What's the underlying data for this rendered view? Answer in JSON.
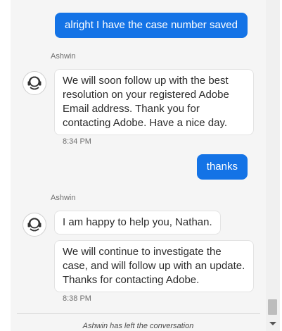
{
  "messages": {
    "user_1": "alright I have the case number saved",
    "agent_name_1": "Ashwin",
    "agent_1": "We will soon follow up with the best resolution on your registered Adobe Email address. Thank you for contacting Adobe. Have a nice day.",
    "time_1": "8:34 PM",
    "user_2": "thanks",
    "agent_name_2": "Ashwin",
    "agent_2a": "I am happy to help you, Nathan.",
    "agent_2b": "We will continue to investigate the case, and will follow up with an update. Thanks for contacting Adobe.",
    "time_2": "8:38 PM"
  },
  "system_note": "Ashwin has left the conversation",
  "icons": {
    "avatar": "agent-headset-icon",
    "scroll_down": "scroll-down-arrow-icon"
  },
  "colors": {
    "user_bubble": "#1473e6",
    "chat_background": "#f5f5f5",
    "agent_bubble": "#ffffff"
  }
}
